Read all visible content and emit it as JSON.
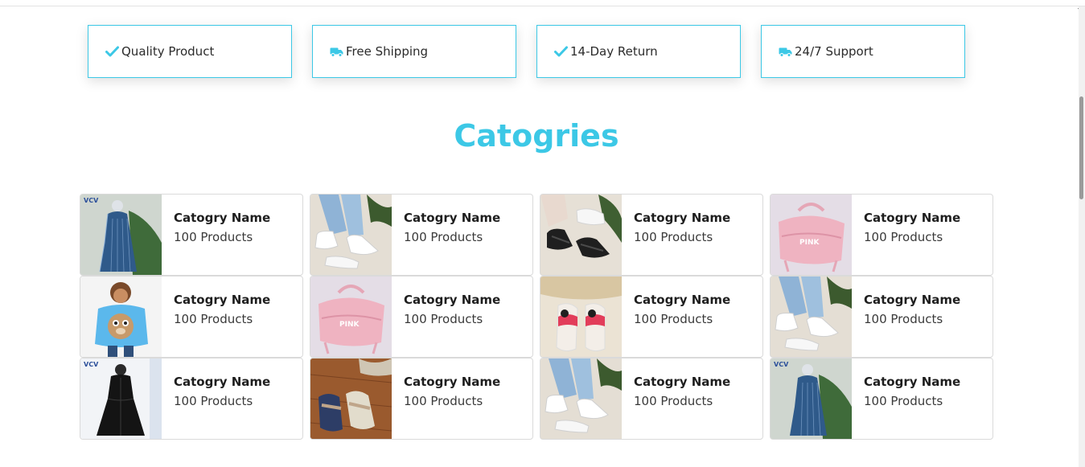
{
  "features": [
    {
      "label": "Quality Product",
      "icon": "check-icon"
    },
    {
      "label": "Free Shipping",
      "icon": "truck-icon"
    },
    {
      "label": "14-Day Return",
      "icon": "check-icon"
    },
    {
      "label": "24/7 Support",
      "icon": "truck-icon"
    }
  ],
  "section": {
    "title": "Catogries"
  },
  "categories": [
    {
      "name": "Catogry Name",
      "count": "100 Products",
      "image": "dress-image"
    },
    {
      "name": "Catogry Name",
      "count": "100 Products",
      "image": "sneakers-image"
    },
    {
      "name": "Catogry Name",
      "count": "100 Products",
      "image": "sandals-image"
    },
    {
      "name": "Catogry Name",
      "count": "100 Products",
      "image": "pink-bag-image"
    },
    {
      "name": "Catogry Name",
      "count": "100 Products",
      "image": "kids-backpack-image"
    },
    {
      "name": "Catogry Name",
      "count": "100 Products",
      "image": "pink-bag-image"
    },
    {
      "name": "Catogry Name",
      "count": "100 Products",
      "image": "kids-slippers-image"
    },
    {
      "name": "Catogry Name",
      "count": "100 Products",
      "image": "sneakers-image"
    },
    {
      "name": "Catogry Name",
      "count": "100 Products",
      "image": "black-abaya-image"
    },
    {
      "name": "Catogry Name",
      "count": "100 Products",
      "image": "slides-image"
    },
    {
      "name": "Catogry Name",
      "count": "100 Products",
      "image": "sneakers-image"
    },
    {
      "name": "Catogry Name",
      "count": "100 Products",
      "image": "dress-image"
    }
  ],
  "colors": {
    "accent": "#3cc8e6",
    "border": "#dadada"
  }
}
